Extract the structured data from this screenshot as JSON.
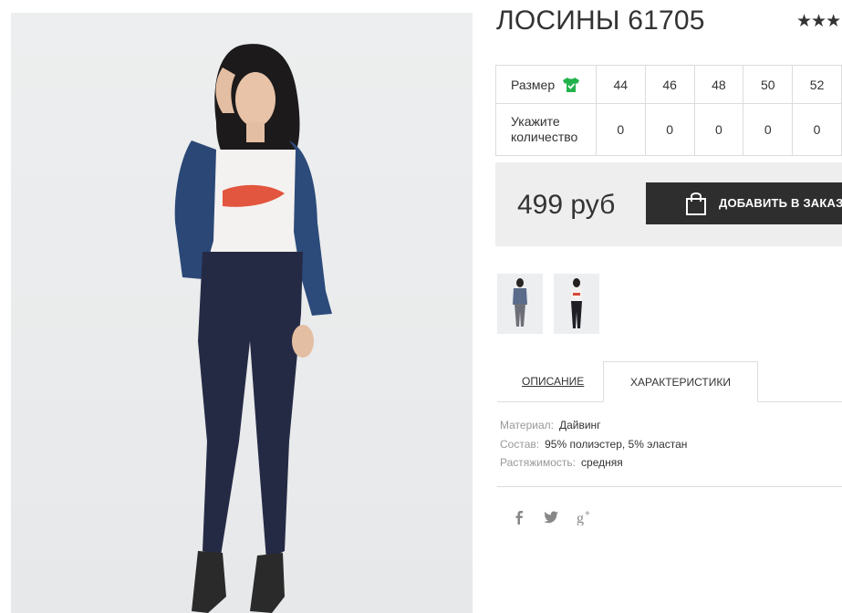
{
  "product": {
    "title": "ЛОСИНЫ 61705",
    "rating_stars": "★★★"
  },
  "sizes": {
    "row_label": "Размер",
    "qty_label_line1": "Укажите",
    "qty_label_line2": "количество",
    "values": [
      "44",
      "46",
      "48",
      "50",
      "52"
    ],
    "quantities": [
      "0",
      "0",
      "0",
      "0",
      "0"
    ]
  },
  "purchase": {
    "price": "499 руб",
    "add_button_label": "ДОБАВИТЬ В ЗАКАЗ"
  },
  "tabs": {
    "description": "ОПИСАНИЕ",
    "characteristics": "ХАРАКТЕРИСТИКИ"
  },
  "specs": [
    {
      "key": "Материал:",
      "value": "Дайвинг"
    },
    {
      "key": "Состав:",
      "value": "95% полиэстер, 5% эластан"
    },
    {
      "key": "Растяжимость:",
      "value": "средняя"
    }
  ],
  "social": [
    "facebook-icon",
    "twitter-icon",
    "google-plus-icon"
  ],
  "colors": {
    "button_bg": "#2e2e2e",
    "price_box_bg": "#eeeeee",
    "size_icon_green": "#22b24c"
  }
}
